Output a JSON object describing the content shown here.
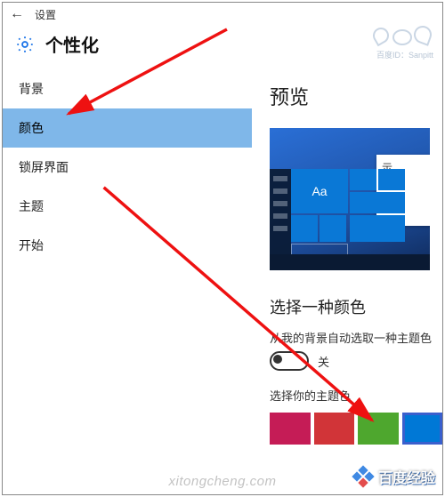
{
  "window": {
    "title": "设置"
  },
  "header": {
    "title": "个性化"
  },
  "sidebar": {
    "items": [
      {
        "label": "背景",
        "selected": false
      },
      {
        "label": "颜色",
        "selected": true
      },
      {
        "label": "锁屏界面",
        "selected": false
      },
      {
        "label": "主题",
        "selected": false
      },
      {
        "label": "开始",
        "selected": false
      }
    ]
  },
  "content": {
    "preview_title": "预览",
    "preview_sample_text": "Aa",
    "preview_window_hint": "示",
    "choose_color_title": "选择一种颜色",
    "auto_pick_label": "从我的背景自动选取一种主题色",
    "toggle_state_label": "关",
    "toggle_on": false,
    "choose_accent_label": "选择你的主题色",
    "swatches": [
      {
        "color": "#c51c56",
        "selected": false
      },
      {
        "color": "#d13438",
        "selected": false
      },
      {
        "color": "#4ea72e",
        "selected": false
      },
      {
        "color": "#0078d6",
        "selected": true
      }
    ]
  },
  "watermark": {
    "top_text": "百度ID：Sanpitt",
    "bottom_text": "百度经验",
    "url_text": "xitongcheng.com"
  }
}
